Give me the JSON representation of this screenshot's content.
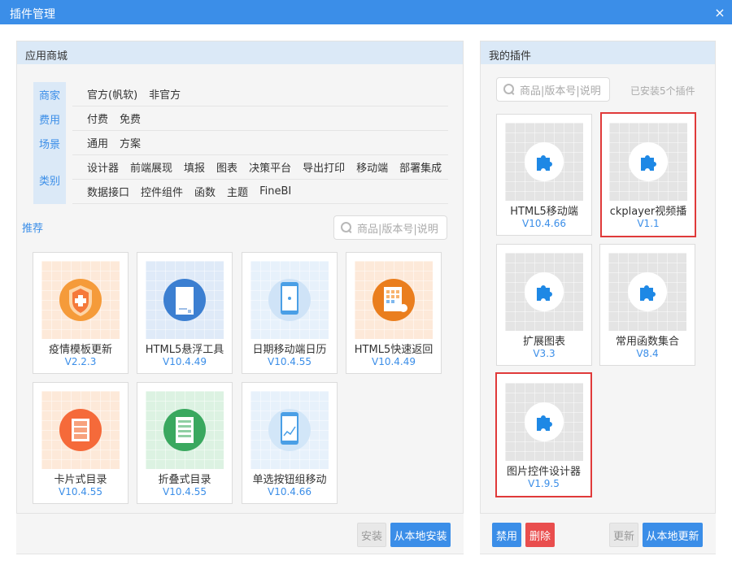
{
  "window": {
    "title": "插件管理",
    "close_glyph": "×"
  },
  "store": {
    "title": "应用商城",
    "filters": [
      {
        "label": "商家",
        "options": [
          "官方(帆软)",
          "非官方"
        ]
      },
      {
        "label": "费用",
        "options": [
          "付费",
          "免费"
        ]
      },
      {
        "label": "场景",
        "options": [
          "通用",
          "方案"
        ]
      },
      {
        "label": "类别",
        "options": [
          "设计器",
          "前端展现",
          "填报",
          "图表",
          "决策平台",
          "导出打印",
          "移动端",
          "部署集成"
        ],
        "options2": [
          "数据接口",
          "控件组件",
          "函数",
          "主题",
          "FineBI"
        ]
      }
    ],
    "recommend_label": "推荐",
    "search_placeholder": "商品|版本号|说明",
    "cards": [
      {
        "name": "疫情模板更新",
        "version": "V2.2.3",
        "theme": "orange",
        "icon": "shield-icon"
      },
      {
        "name": "HTML5悬浮工具",
        "version": "V10.4.49",
        "theme": "blue",
        "icon": "document-icon"
      },
      {
        "name": "日期移动端日历",
        "version": "V10.4.55",
        "theme": "lightblue",
        "icon": "phone-icon"
      },
      {
        "name": "HTML5快速返回",
        "version": "V10.4.49",
        "theme": "orange",
        "icon": "grid-icon"
      },
      {
        "name": "卡片式目录",
        "version": "V10.4.55",
        "theme": "orange",
        "icon": "cards-icon"
      },
      {
        "name": "折叠式目录",
        "version": "V10.4.55",
        "theme": "green",
        "icon": "list-icon"
      },
      {
        "name": "单选按钮组移动",
        "version": "V10.4.66",
        "theme": "lightblue",
        "icon": "chart-phone-icon"
      }
    ],
    "buttons": {
      "install": "安装",
      "install_local": "从本地安装"
    }
  },
  "mine": {
    "title": "我的插件",
    "search_placeholder": "商品|版本号|说明",
    "installed_text": "已安装5个插件",
    "plugins": [
      {
        "name": "HTML5移动端",
        "version": "V10.4.66",
        "selected": false
      },
      {
        "name": "ckplayer视频播",
        "version": "V1.1",
        "selected": true
      },
      {
        "name": "扩展图表",
        "version": "V3.3",
        "selected": false
      },
      {
        "name": "常用函数集合",
        "version": "V8.4",
        "selected": false
      },
      {
        "name": "图片控件设计器",
        "version": "V1.9.5",
        "selected": true
      }
    ],
    "buttons": {
      "disable": "禁用",
      "delete": "删除",
      "update": "更新",
      "update_local": "从本地更新"
    }
  },
  "colors": {
    "accent": "#3b8ee8",
    "danger": "#e94e4e",
    "selected_border": "#e03a3a",
    "header_bg": "#dbe9f7"
  }
}
